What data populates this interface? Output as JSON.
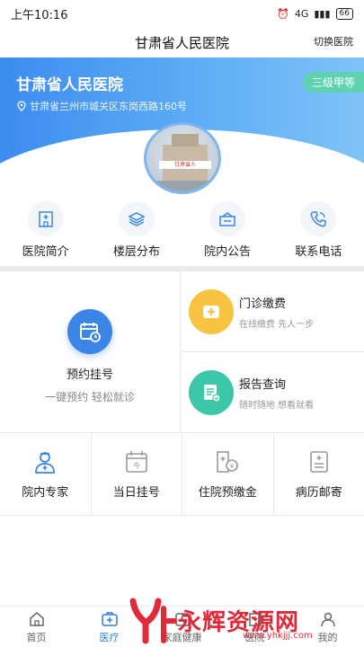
{
  "status": {
    "time": "上午10:16",
    "network": "4G",
    "battery": "66"
  },
  "header": {
    "title": "甘肃省人民医院",
    "switch_label": "切换医院"
  },
  "hospital": {
    "name": "甘肃省人民医院",
    "address": "甘肃省兰州市城关区东岗西路160号",
    "level": "三级甲等",
    "sign_text": "甘肃省人"
  },
  "quick_links": [
    {
      "label": "医院简介",
      "icon": "hospital-building-icon"
    },
    {
      "label": "楼层分布",
      "icon": "layers-icon"
    },
    {
      "label": "院内公告",
      "icon": "notice-icon"
    },
    {
      "label": "联系电话",
      "icon": "phone-icon"
    }
  ],
  "services": {
    "appointment": {
      "title": "预约挂号",
      "subtitle": "一键预约 轻松就诊"
    },
    "payment": {
      "title": "门诊缴费",
      "subtitle": "在线缴费 先人一步"
    },
    "report": {
      "title": "报告查询",
      "subtitle": "随时随地 想看就看"
    }
  },
  "bottom_services": [
    {
      "label": "院内专家",
      "icon": "doctor-icon"
    },
    {
      "label": "当日挂号",
      "icon": "calendar-today-icon"
    },
    {
      "label": "住院预缴金",
      "icon": "deposit-icon"
    },
    {
      "label": "病历邮寄",
      "icon": "medical-record-icon"
    }
  ],
  "tabs": [
    {
      "label": "首页",
      "icon": "home-icon"
    },
    {
      "label": "医疗",
      "icon": "medical-kit-icon"
    },
    {
      "label": "家庭健康",
      "icon": "family-health-icon"
    },
    {
      "label": "医院",
      "icon": "hospital-icon"
    },
    {
      "label": "我的",
      "icon": "user-icon"
    }
  ],
  "watermark": {
    "text": "永辉资源网",
    "url": "www.yhkjjj.com"
  },
  "colors": {
    "primary": "#3a85e6",
    "badge": "#5fd3b0",
    "payment": "#f7c341",
    "report": "#3cc7a8",
    "watermark": "#e02a3a"
  }
}
